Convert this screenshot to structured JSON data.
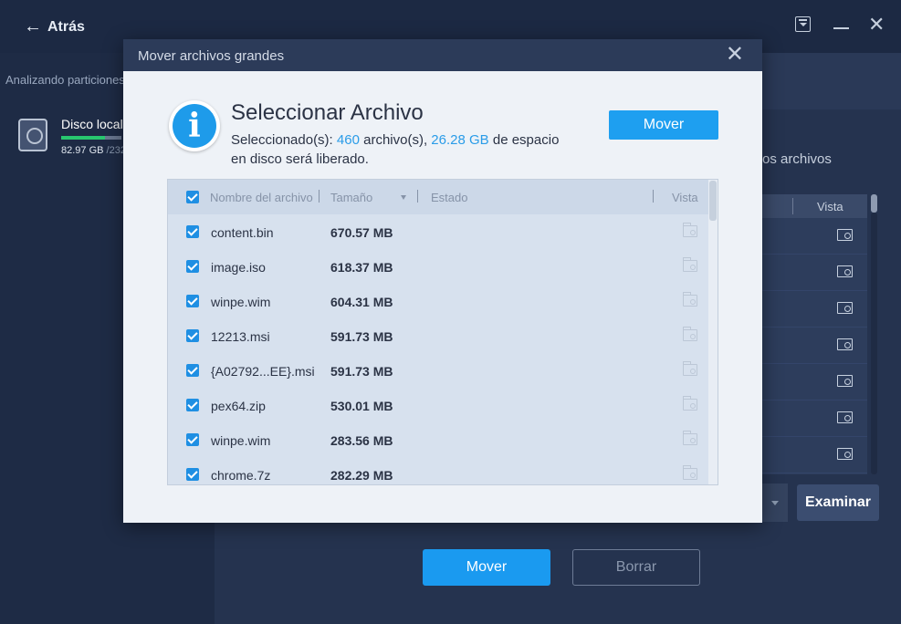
{
  "app": {
    "back_label": "Atrás",
    "scan_text": "Analizando particiones",
    "disk": {
      "name": "Disco local",
      "used": "82.97 GB",
      "total": " /232",
      "usage_fraction": 0.73
    },
    "section_title": "os archivos",
    "table_view_header": "Vista",
    "examinar_label": "Examinar",
    "mover_label": "Mover",
    "borrar_label": "Borrar"
  },
  "dialog": {
    "title": "Mover archivos grandes",
    "heading": "Seleccionar Archivo",
    "desc_prefix": "Seleccionado(s): ",
    "count": "460",
    "desc_mid": " archivo(s), ",
    "space": "26.28 GB",
    "desc_suffix": " de espacio en disco será liberado.",
    "mover_label": "Mover",
    "columns": {
      "name": "Nombre del archivo",
      "size": "Tamaño",
      "status": "Estado",
      "view": "Vista"
    },
    "files": [
      {
        "name": "content.bin",
        "size": "670.57 MB"
      },
      {
        "name": "image.iso",
        "size": "618.37 MB"
      },
      {
        "name": "winpe.wim",
        "size": "604.31 MB"
      },
      {
        "name": "12213.msi",
        "size": "591.73 MB"
      },
      {
        "name": "{A02792...EE}.msi",
        "size": "591.73 MB"
      },
      {
        "name": "pex64.zip",
        "size": "530.01 MB"
      },
      {
        "name": "winpe.wim",
        "size": "283.56 MB"
      },
      {
        "name": "chrome.7z",
        "size": "282.29 MB"
      }
    ]
  },
  "colors": {
    "accent": "#1e9ff0",
    "highlight": "#2a9ce8",
    "dialog_bg": "#eef2f7",
    "app_bg": "#1b2740"
  },
  "icons": [
    "back-arrow-icon",
    "dropdown-icon",
    "minimize-icon",
    "close-icon",
    "disk-icon",
    "info-icon",
    "checkbox-icon",
    "folder-search-icon"
  ]
}
